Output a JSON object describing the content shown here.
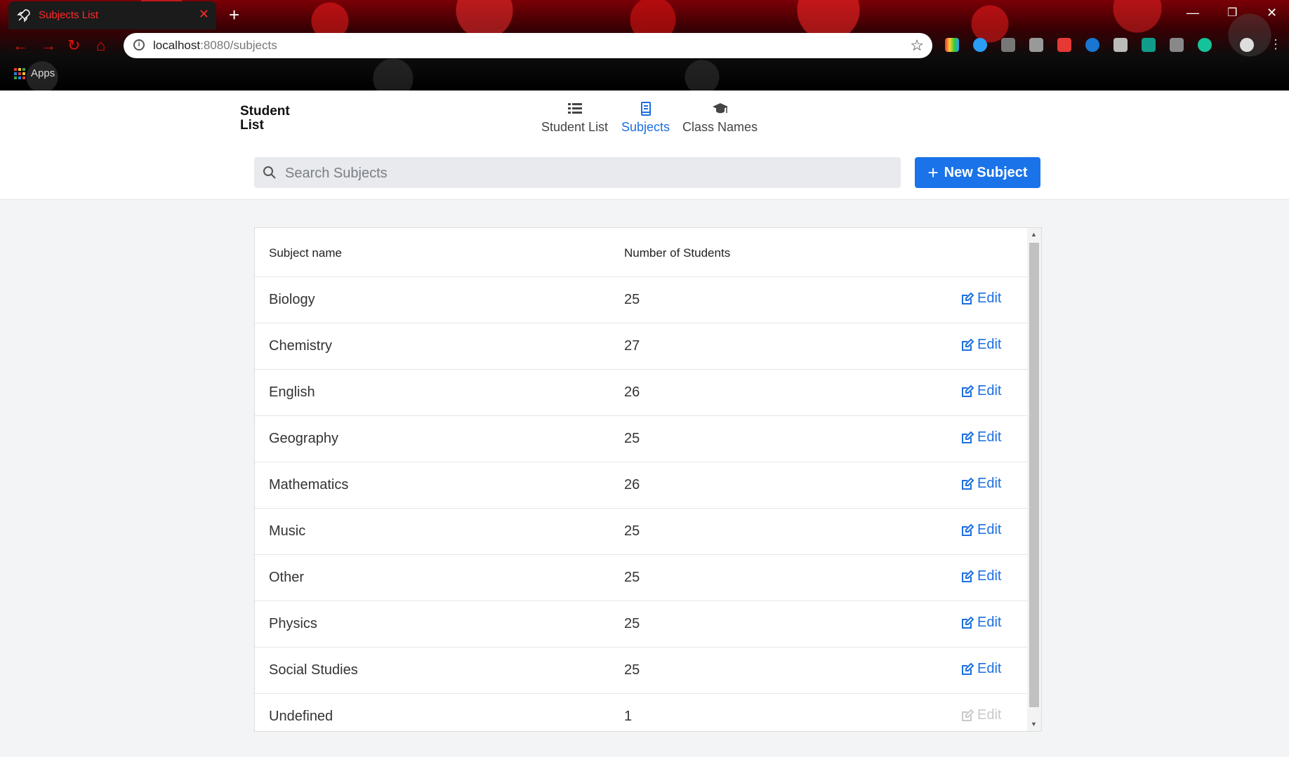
{
  "browser": {
    "tab_title": "Subjects List",
    "url_host": "localhost",
    "url_rest": ":8080/subjects",
    "bookmarks_apps": "Apps"
  },
  "app": {
    "brand": "Student List",
    "nav": [
      {
        "label": "Student List",
        "icon": "list-icon",
        "active": false
      },
      {
        "label": "Subjects",
        "icon": "book-icon",
        "active": true
      },
      {
        "label": "Class Names",
        "icon": "graduation-cap-icon",
        "active": false
      }
    ],
    "search_placeholder": "Search Subjects",
    "new_button": "New Subject"
  },
  "table": {
    "headers": [
      "Subject name",
      "Number of Students"
    ],
    "edit_label": "Edit",
    "rows": [
      {
        "name": "Biology",
        "count": "25",
        "editable": true
      },
      {
        "name": "Chemistry",
        "count": "27",
        "editable": true
      },
      {
        "name": "English",
        "count": "26",
        "editable": true
      },
      {
        "name": "Geography",
        "count": "25",
        "editable": true
      },
      {
        "name": "Mathematics",
        "count": "26",
        "editable": true
      },
      {
        "name": "Music",
        "count": "25",
        "editable": true
      },
      {
        "name": "Other",
        "count": "25",
        "editable": true
      },
      {
        "name": "Physics",
        "count": "25",
        "editable": true
      },
      {
        "name": "Social Studies",
        "count": "25",
        "editable": true
      },
      {
        "name": "Undefined",
        "count": "1",
        "editable": false
      }
    ]
  },
  "colors": {
    "accent": "#1a73e8",
    "active_nav": "#1c6fe0",
    "tab_text": "#ff2a2a"
  }
}
